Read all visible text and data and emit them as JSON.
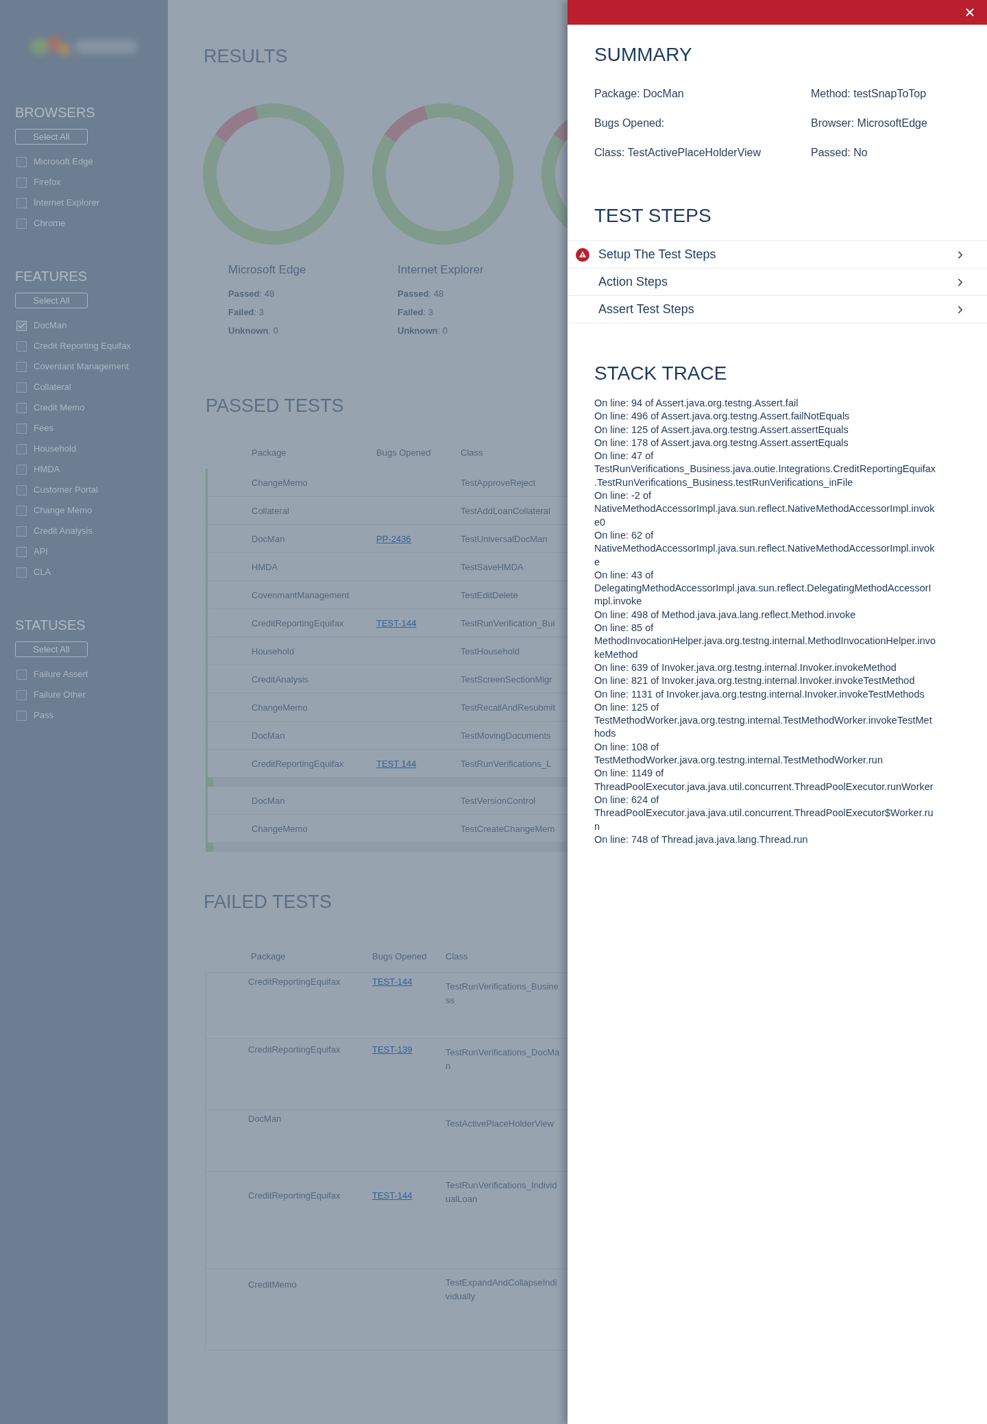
{
  "sidebar": {
    "sections": [
      {
        "title": "BROWSERS",
        "button": "Select All",
        "items": [
          {
            "label": "Microsoft Edge",
            "checked": false
          },
          {
            "label": "Firefox",
            "checked": false
          },
          {
            "label": "Internet Explorer",
            "checked": false
          },
          {
            "label": "Chrome",
            "checked": false
          }
        ]
      },
      {
        "title": "FEATURES",
        "button": "Select All",
        "items": [
          {
            "label": "DocMan",
            "checked": true
          },
          {
            "label": "Credit Reporting Equifax",
            "checked": false
          },
          {
            "label": "Coventant Management",
            "checked": false
          },
          {
            "label": "Collateral",
            "checked": false
          },
          {
            "label": "Credit Memo",
            "checked": false
          },
          {
            "label": "Fees",
            "checked": false
          },
          {
            "label": "Household",
            "checked": false
          },
          {
            "label": "HMDA",
            "checked": false
          },
          {
            "label": "Customer Portal",
            "checked": false
          },
          {
            "label": "Change Memo",
            "checked": false
          },
          {
            "label": "Credit Analysis",
            "checked": false
          },
          {
            "label": "API",
            "checked": false
          },
          {
            "label": "CLA",
            "checked": false
          }
        ]
      },
      {
        "title": "STATUSES",
        "button": "Select All",
        "items": [
          {
            "label": "Failure Assert",
            "checked": false
          },
          {
            "label": "Failure Other",
            "checked": false
          },
          {
            "label": "Pass",
            "checked": false
          }
        ]
      }
    ]
  },
  "results": {
    "title": "RESULTS",
    "charts": [
      {
        "name": "Microsoft Edge",
        "stats": [
          "**Passed**: 48",
          "**Failed**: 3",
          "**Unknown**: 0"
        ]
      },
      {
        "name": "Internet Explorer",
        "stats": [
          "**Passed**: 48",
          "**Failed**: 3",
          "**Unknown**: 0"
        ]
      }
    ]
  },
  "passed_tests": {
    "title": "PASSED TESTS",
    "columns": [
      "Package",
      "Bugs Opened",
      "Class"
    ],
    "row_groups": [
      [
        {
          "package": "ChangeMemo",
          "class": "TestApproveReject"
        },
        {
          "package": "Collateral",
          "class": "TestAddLoanCollateral"
        },
        {
          "package": "DocMan",
          "bugs_opened": "PP-2436",
          "class": "TestUniversalDocMan"
        },
        {
          "package": "HMDA",
          "class": "TestSaveHMDA"
        },
        {
          "package": "CovenmantManagement",
          "class": "TestEditDelete"
        },
        {
          "package": "CreditReportingEquifax",
          "bugs_opened": "TEST-144",
          "class": "TestRunVerification_Bui"
        },
        {
          "package": "Household",
          "class": "TestHousehold"
        },
        {
          "package": "CreditAnalysis",
          "class": "TestScreenSectionMigr"
        },
        {
          "package": "ChangeMemo",
          "class": "TestRecallAndResubmit"
        },
        {
          "package": "DocMan",
          "class": "TestMovingDocuments"
        },
        {
          "package": "CreditReportingEquifax",
          "bugs_opened": "TEST 144",
          "class": "TestRunVerifications_L"
        }
      ],
      [
        {
          "package": "DocMan",
          "class": "TestVersionControl"
        },
        {
          "package": "ChangeMemo",
          "class": "TestCreateChangeMem"
        }
      ]
    ]
  },
  "failed_tests": {
    "title": "FAILED TESTS",
    "columns": [
      "Package",
      "Bugs Opened",
      "Class"
    ],
    "rows": [
      {
        "package": "CreditReportingEquifax",
        "bugs_opened": "TEST-144",
        "class": "TestRunVerifications_Business"
      },
      {
        "package": "CreditReportingEquifax",
        "bugs_opened": "TEST-139",
        "class": "TestRunVerifications_DocMan"
      },
      {
        "package": "DocMan",
        "class": "TestActivePlaceHolderView"
      },
      {
        "package": "CreditReportingEquifax",
        "bugs_opened": "TEST-144",
        "class": "TestRunVerifications_IndividualLoan"
      },
      {
        "package": "CreditMemo",
        "class": "TestExpandAndCollapseIndividually"
      }
    ]
  },
  "details_panel": {
    "summary": {
      "title": "SUMMARY",
      "fields": [
        "Package: DocMan",
        "Method: testSnapToTop",
        "Bugs Opened:",
        "Browser: MicrosoftEdge",
        "Class: TestActivePlaceHolderView",
        "Passed: No"
      ]
    },
    "test_steps": {
      "title": "TEST STEPS",
      "steps": [
        {
          "label": "Setup The Test Steps",
          "failed": true,
          "expanded": false
        },
        {
          "label": "Action Steps",
          "failed": false,
          "expanded": false
        },
        {
          "label": "Assert Test Steps",
          "failed": false,
          "expanded": false
        }
      ]
    },
    "stack_trace": {
      "title": "STACK TRACE",
      "lines": [
        "On line: 94 of Assert.java.org.testng.Assert.fail",
        "On line: 496 of Assert.java.org.testng.Assert.failNotEquals",
        "On line: 125 of Assert.java.org.testng.Assert.assertEquals",
        "On line: 178 of Assert.java.org.testng.Assert.assertEquals",
        "On line: 47 of TestRunVerifications_Business.java.outie.Integrations.CreditReportingEquifax.TestRunVerifications_Business.testRunVerifications_inFile",
        "On line: -2 of NativeMethodAccessorImpl.java.sun.reflect.NativeMethodAccessorImpl.invoke0",
        "On line: 62 of NativeMethodAccessorImpl.java.sun.reflect.NativeMethodAccessorImpl.invoke",
        "On line: 43 of DelegatingMethodAccessorImpl.java.sun.reflect.DelegatingMethodAccessorImpl.invoke",
        "On line: 498 of Method.java.java.lang.reflect.Method.invoke",
        "On line: 85 of MethodInvocationHelper.java.org.testng.internal.MethodInvocationHelper.invokeMethod",
        "On line: 639 of Invoker.java.org.testng.internal.Invoker.invokeMethod",
        "On line: 821 of Invoker.java.org.testng.internal.Invoker.invokeTestMethod",
        "On line: 1131 of Invoker.java.org.testng.internal.Invoker.invokeTestMethods",
        "On line: 125 of TestMethodWorker.java.org.testng.internal.TestMethodWorker.invokeTestMethods",
        "On line: 108 of TestMethodWorker.java.org.testng.internal.TestMethodWorker.run",
        "On line: 1149 of ThreadPoolExecutor.java.java.util.concurrent.ThreadPoolExecutor.runWorker",
        "On line: 624 of ThreadPoolExecutor.java.java.util.concurrent.ThreadPoolExecutor$Worker.run",
        "On line: 748 of Thread.java.java.lang.Thread.run"
      ]
    }
  }
}
